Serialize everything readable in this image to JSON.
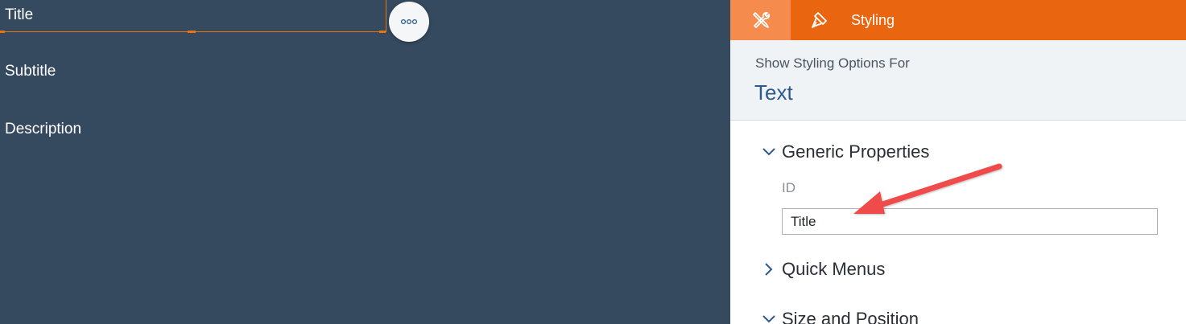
{
  "canvas": {
    "widgets": [
      {
        "label": "Title"
      },
      {
        "label": "Subtitle"
      },
      {
        "label": "Description"
      }
    ],
    "more_button": {
      "icon": "more-dots-icon"
    }
  },
  "panel": {
    "tabs": {
      "builder_icon": "tools-icon",
      "styling_icon": "paint-brush-icon",
      "styling_label": "Styling"
    },
    "subheader": {
      "caption": "Show Styling Options For",
      "target": "Text"
    },
    "sections": [
      {
        "label": "Generic Properties",
        "expanded": true
      },
      {
        "label": "Quick Menus",
        "expanded": false
      },
      {
        "label": "Size and Position",
        "expanded": true
      }
    ],
    "id_field": {
      "label": "ID",
      "value": "Title"
    }
  },
  "colors": {
    "canvas_bg": "#354a5f",
    "accent_orange": "#e9650f",
    "accent_orange_light": "#f58b4c",
    "selection": "#e9730c",
    "annotation_arrow": "#ef4b4b",
    "target_text": "#2b5a8a"
  }
}
